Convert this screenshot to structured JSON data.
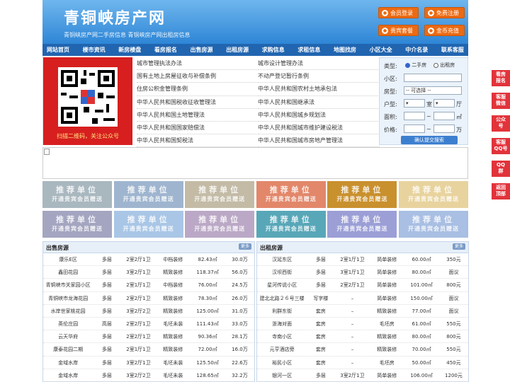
{
  "header": {
    "title": "青铜峡房产网",
    "subtitle": "青铜峡房产网二手房信息  青铜峡房产网出租房信息",
    "buttons": [
      "会员登录",
      "免费注册",
      "贵宾套餐",
      "金币充值"
    ]
  },
  "nav": [
    "网站首页",
    "楼市资讯",
    "新房楼盘",
    "看房报名",
    "出售房源",
    "出租房源",
    "求购信息",
    "求租信息",
    "地图找房",
    "小区大全",
    "中介名录",
    "联系客服"
  ],
  "qr": {
    "caption": "扫描二维码，关注公众号"
  },
  "laws_left": [
    "城市管理执法办法",
    "国有土地上房屋征收与补偿条例",
    "住房公积金管理条例",
    "中华人民共和国税收征收管理法",
    "中华人民共和国土地管理法",
    "中华人民共和国国家赔偿法",
    "中华人民共和国契税法"
  ],
  "laws_right": [
    "城市设计管理办法",
    "不动产登记暂行条例",
    "中华人民共和国农村土地承包法",
    "中华人民共和国继承法",
    "中华人民共和国城乡规划法",
    "中华人民共和国城市维护建设税法",
    "中华人民共和国城市房地产管理法"
  ],
  "search": {
    "type_label": "类型:",
    "opt1": "二手房",
    "opt2": "出租房",
    "community_label": "小区:",
    "house_label": "房型:",
    "house_select": "-- 可选择 --",
    "layout_label": "户型:",
    "room_unit": "室",
    "hall_unit": "厅",
    "area_label": "面积:",
    "area_sep": "~",
    "area_unit": "㎡",
    "price_label": "价格:",
    "price_sep": "~",
    "price_unit": "万",
    "submit": "确认提交搜索"
  },
  "ads": {
    "line1": "推荐单位",
    "line2": "开通贵宾会员赠送",
    "colors": [
      "#a9b7bf",
      "#9fb5cf",
      "#c3bba6",
      "#e2876a",
      "#c9902e",
      "#e8d39e",
      "#a4a5c0",
      "#a9c6e6",
      "#bba8c6",
      "#58a7b8",
      "#9b9fd6",
      "#a9bfe3"
    ]
  },
  "sale": {
    "title": "出售房源",
    "more": "更多",
    "rows": [
      [
        "康乐E区",
        "多层",
        "2室2厅1卫",
        "中档装修",
        "82.43㎡",
        "30.0万"
      ],
      [
        "鑫田花园",
        "多层",
        "3室2厅1卫",
        "精致装修",
        "118.37㎡",
        "56.0万"
      ],
      [
        "青铜峡市关家园小区",
        "多层",
        "2室1厅1卫",
        "中档装修",
        "76.00㎡",
        "24.5万"
      ],
      [
        "青铜峡市龙海花园",
        "多层",
        "2室2厅1卫",
        "精致装修",
        "78.30㎡",
        "26.0万"
      ],
      [
        "水岸世家桃花园",
        "多层",
        "3室2厅2卫",
        "精致装修",
        "125.00㎡",
        "31.0万"
      ],
      [
        "英伦庄园",
        "高层",
        "2室2厅1卫",
        "毛坯未装",
        "111.43㎡",
        "33.0万"
      ],
      [
        "云天华府",
        "多层",
        "2室2厅1卫",
        "精致装修",
        "90.36㎡",
        "28.1万"
      ],
      [
        "康泰花园二期",
        "多层",
        "2室1厅1卫",
        "精致装修",
        "72.00㎡",
        "16.0万"
      ],
      [
        "金域水岸",
        "多层",
        "3室2厅1卫",
        "毛坯未装",
        "125.50㎡",
        "22.6万"
      ],
      [
        "金域水岸",
        "多层",
        "3室2厅2卫",
        "毛坯未装",
        "128.65㎡",
        "32.2万"
      ]
    ]
  },
  "rent": {
    "title": "出租房源",
    "more": "更多",
    "rows": [
      [
        "汉延东区",
        "多层",
        "2室1厅1卫",
        "简单装修",
        "60.00㎡",
        "350元"
      ],
      [
        "汉坝西街",
        "多层",
        "3室1厅1卫",
        "简单装修",
        "80.00㎡",
        "面议"
      ],
      [
        "星河传说小区",
        "多层",
        "2室2厅1卫",
        "简单装修",
        "101.00㎡",
        "800元"
      ],
      [
        "建北北路２６号三楼",
        "写字楼",
        "–",
        "简单装修",
        "150.00㎡",
        "面议"
      ],
      [
        "利群东街",
        "套房",
        "–",
        "精致装修",
        "77.00㎡",
        "面议"
      ],
      [
        "浙海对面",
        "套房",
        "–",
        "毛坯房",
        "61.00㎡",
        "550元"
      ],
      [
        "寺南小区",
        "套房",
        "–",
        "精致装修",
        "80.00㎡",
        "800元"
      ],
      [
        "元亨酒店旁",
        "套房",
        "–",
        "精致装修",
        "70.00㎡",
        "550元"
      ],
      [
        "裕民小区",
        "套房",
        "–",
        "毛坯房",
        "50.00㎡",
        "450元"
      ],
      [
        "银河一区",
        "多层",
        "3室2厅1卫",
        "简单装修",
        "106.00㎡",
        "1200元"
      ]
    ]
  },
  "rightbar": [
    [
      "看房",
      "报名"
    ],
    [
      "客服",
      "微信"
    ],
    [
      "公众",
      "号"
    ],
    [
      "客服",
      "QQ号"
    ],
    [
      "QQ",
      "群"
    ],
    [
      "返回",
      "顶部"
    ]
  ]
}
